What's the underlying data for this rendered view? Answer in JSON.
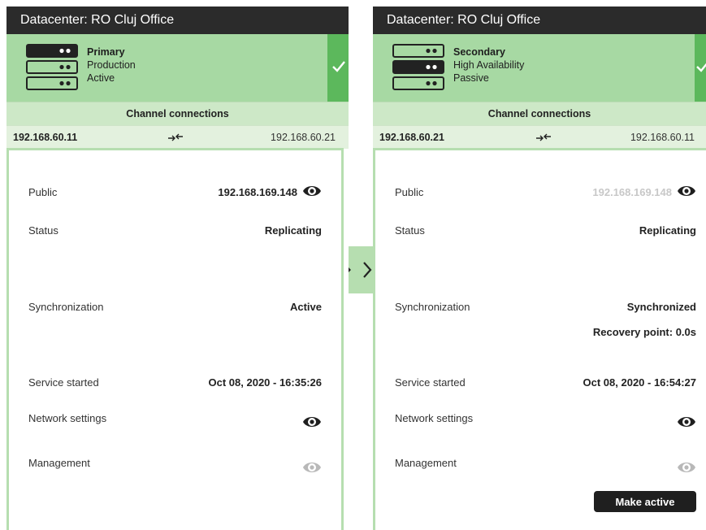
{
  "panels": [
    {
      "datacenter_title": "Datacenter: RO Cluj Office",
      "role": "Primary",
      "mode": "Production",
      "state": "Active",
      "channel_header": "Channel connections",
      "channel_local": "192.168.60.11",
      "channel_remote": "192.168.60.21",
      "public_label": "Public",
      "public_value": "192.168.169.148",
      "status_label": "Status",
      "status_value": "Replicating",
      "sync_label": "Synchronization",
      "sync_value": "Active",
      "service_label": "Service started",
      "service_value": "Oct 08, 2020 - 16:35:26",
      "network_label": "Network settings",
      "management_label": "Management"
    },
    {
      "datacenter_title": "Datacenter: RO Cluj Office",
      "role": "Secondary",
      "mode": "High Availability",
      "state": "Passive",
      "channel_header": "Channel connections",
      "channel_local": "192.168.60.21",
      "channel_remote": "192.168.60.11",
      "public_label": "Public",
      "public_value": "192.168.169.148",
      "status_label": "Status",
      "status_value": "Replicating",
      "sync_label": "Synchronization",
      "sync_value": "Synchronized",
      "recovery_point": "Recovery point: 0.0s",
      "service_label": "Service started",
      "service_value": "Oct 08, 2020 - 16:54:27",
      "network_label": "Network settings",
      "management_label": "Management",
      "make_active_label": "Make active"
    }
  ],
  "icons": {
    "server": "server-stack-icon",
    "check": "check-icon",
    "transfer": "transfer-arrows-icon",
    "eye": "eye-icon",
    "switch": "chevron-right-icon"
  },
  "colors": {
    "title_bar": "#2b2b2b",
    "role_box": "#a7d9a3",
    "active_strip": "#5cb85c",
    "channel_header": "#cde8c7",
    "channel_row": "#e3f1de",
    "border": "#b6deb0",
    "button": "#1f1f1f"
  }
}
